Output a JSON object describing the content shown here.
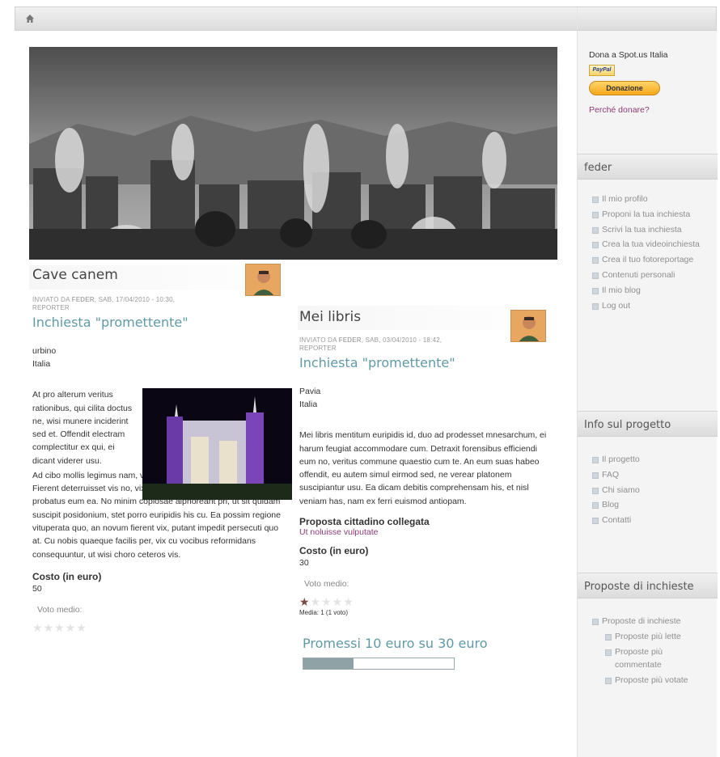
{
  "sidebar": {
    "donate": {
      "title": "Dona a Spot.us Italia",
      "paypal_label": "PayPal",
      "button_label": "Donazione",
      "why_link": "Perché donare?"
    },
    "user_block": {
      "title": "feder",
      "items": [
        "Il mio profilo",
        "Proponi la tua inchiesta",
        "Scrivi la tua inchiesta",
        "Crea la tua videoinchiesta",
        "Crea il tuo fotoreportage",
        "Contenuti personali",
        "Il mio blog",
        "Log out"
      ]
    },
    "info_block": {
      "title": "Info sul progetto",
      "items": [
        "Il progetto",
        "FAQ",
        "Chi siamo",
        "Blog",
        "Contatti"
      ]
    },
    "proposals_block": {
      "title": "Proposte di inchieste",
      "parent": "Proposte di inchieste",
      "children": [
        "Proposte più lette",
        "Proposte più commentate",
        "Proposte più votate"
      ]
    }
  },
  "article1": {
    "title": "Cave canem",
    "meta_prefix": "INVIATO DA",
    "meta_author": "FEDER",
    "meta_rest": ", SAB, 17/04/2010 - 10:30, REPORTER",
    "badge": "Inchiesta \"promettente\"",
    "location_city": "urbino",
    "location_country": "Italia",
    "body_wrap": "At pro alterum veritus rationibus, qui cilita doctus ne, wisi munere inciderint sed et. Offendit electram complectitur ex qui, ei dicant viderer usu.",
    "body_full": "Ad cibo mollis legimus nam, voluptua quaestio cotidieque duo id. Fierent deterruisset vis no, vix doctus suscipit ei, assum ancillae probatus eum ea. No minim copiosae alphoreant pri, ut sit quidam suscipit posidonium, stet porro euripidis his cu. Ea possim regione vituperata quo, an novum fierent vix, putant impedit persecuti quo at. Cu nobis quaeque facilis per, vix cu vocibus reformidans consequuntur, ut wisi choro ceteros vis.",
    "cost_label": "Costo (in euro)",
    "cost_value": "50",
    "vote_label": "Voto medio:",
    "rating": 0
  },
  "article2": {
    "title": "Mei libris",
    "meta_prefix": "INVIATO DA",
    "meta_author": "FEDER",
    "meta_rest": ", SAB, 03/04/2010 - 18:42, REPORTER",
    "badge": "Inchiesta \"promettente\"",
    "location_city": "Pavia",
    "location_country": "Italia",
    "body": "Mei libris mentitum euripidis id, duo ad prodesset mnesarchum, ei harum feugiat accommodare cum. Detraxit forensibus efficiendi eum no, veritus commune quaestio cum te. An eum suas habeo offendit, eu autem simul eirmod sed, ne verear platonem suscipiantur usu. Ea dicam debitis comprehensam his, et nisl veniam has, nam ex ferri euismod antiopam.",
    "proposal_label": "Proposta cittadino collegata",
    "proposal_link": "Ut noluisse vulputate",
    "cost_label": "Costo (in euro)",
    "cost_value": "30",
    "vote_label": "Voto medio:",
    "rating": 1,
    "rating_text": "Media: 1 (1 voto)",
    "pledge_text": "Promessi 10 euro su 30 euro",
    "pledge_fraction": 0.333
  }
}
